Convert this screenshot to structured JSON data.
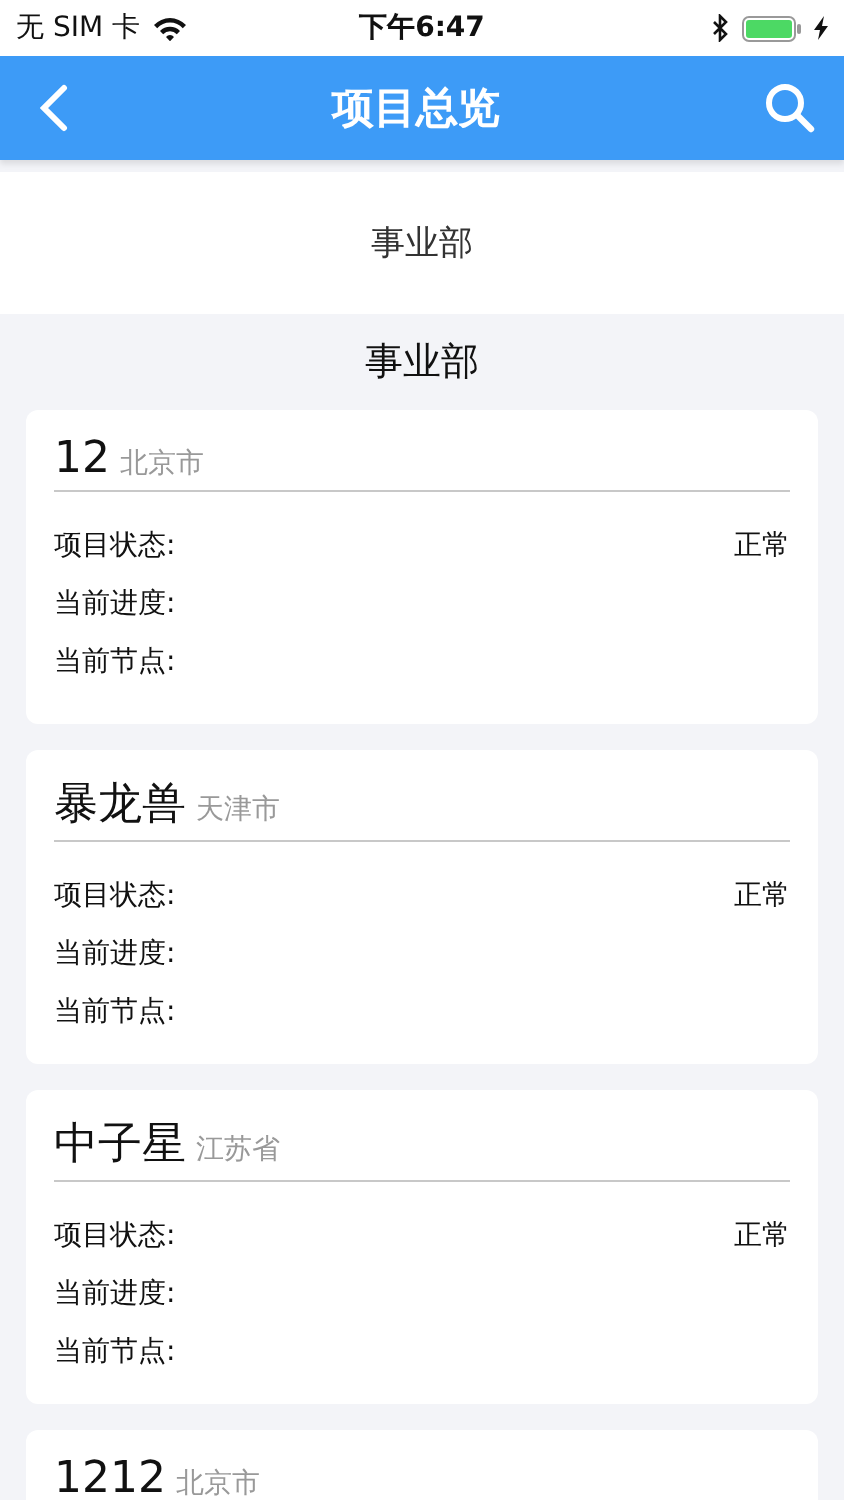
{
  "status_bar": {
    "carrier": "无 SIM 卡",
    "time": "下午6:47"
  },
  "nav_bar": {
    "title": "项目总览"
  },
  "filter": {
    "label": "事业部"
  },
  "section": {
    "title": "事业部"
  },
  "projects": [
    {
      "name": "12",
      "region": "北京市",
      "fields": [
        {
          "label": "项目状态:",
          "value": "正常"
        },
        {
          "label": "当前进度:"
        },
        {
          "label": "当前节点:"
        }
      ]
    },
    {
      "name": "暴龙兽",
      "region": "天津市",
      "fields": [
        {
          "label": "项目状态:",
          "value": "正常"
        },
        {
          "label": "当前进度:"
        },
        {
          "label": "当前节点:"
        }
      ]
    },
    {
      "name": "中子星",
      "region": "江苏省",
      "fields": [
        {
          "label": "项目状态:",
          "value": "正常"
        },
        {
          "label": "当前进度:"
        },
        {
          "label": "当前节点:"
        }
      ]
    },
    {
      "name": "1212",
      "region": "北京市"
    }
  ]
}
